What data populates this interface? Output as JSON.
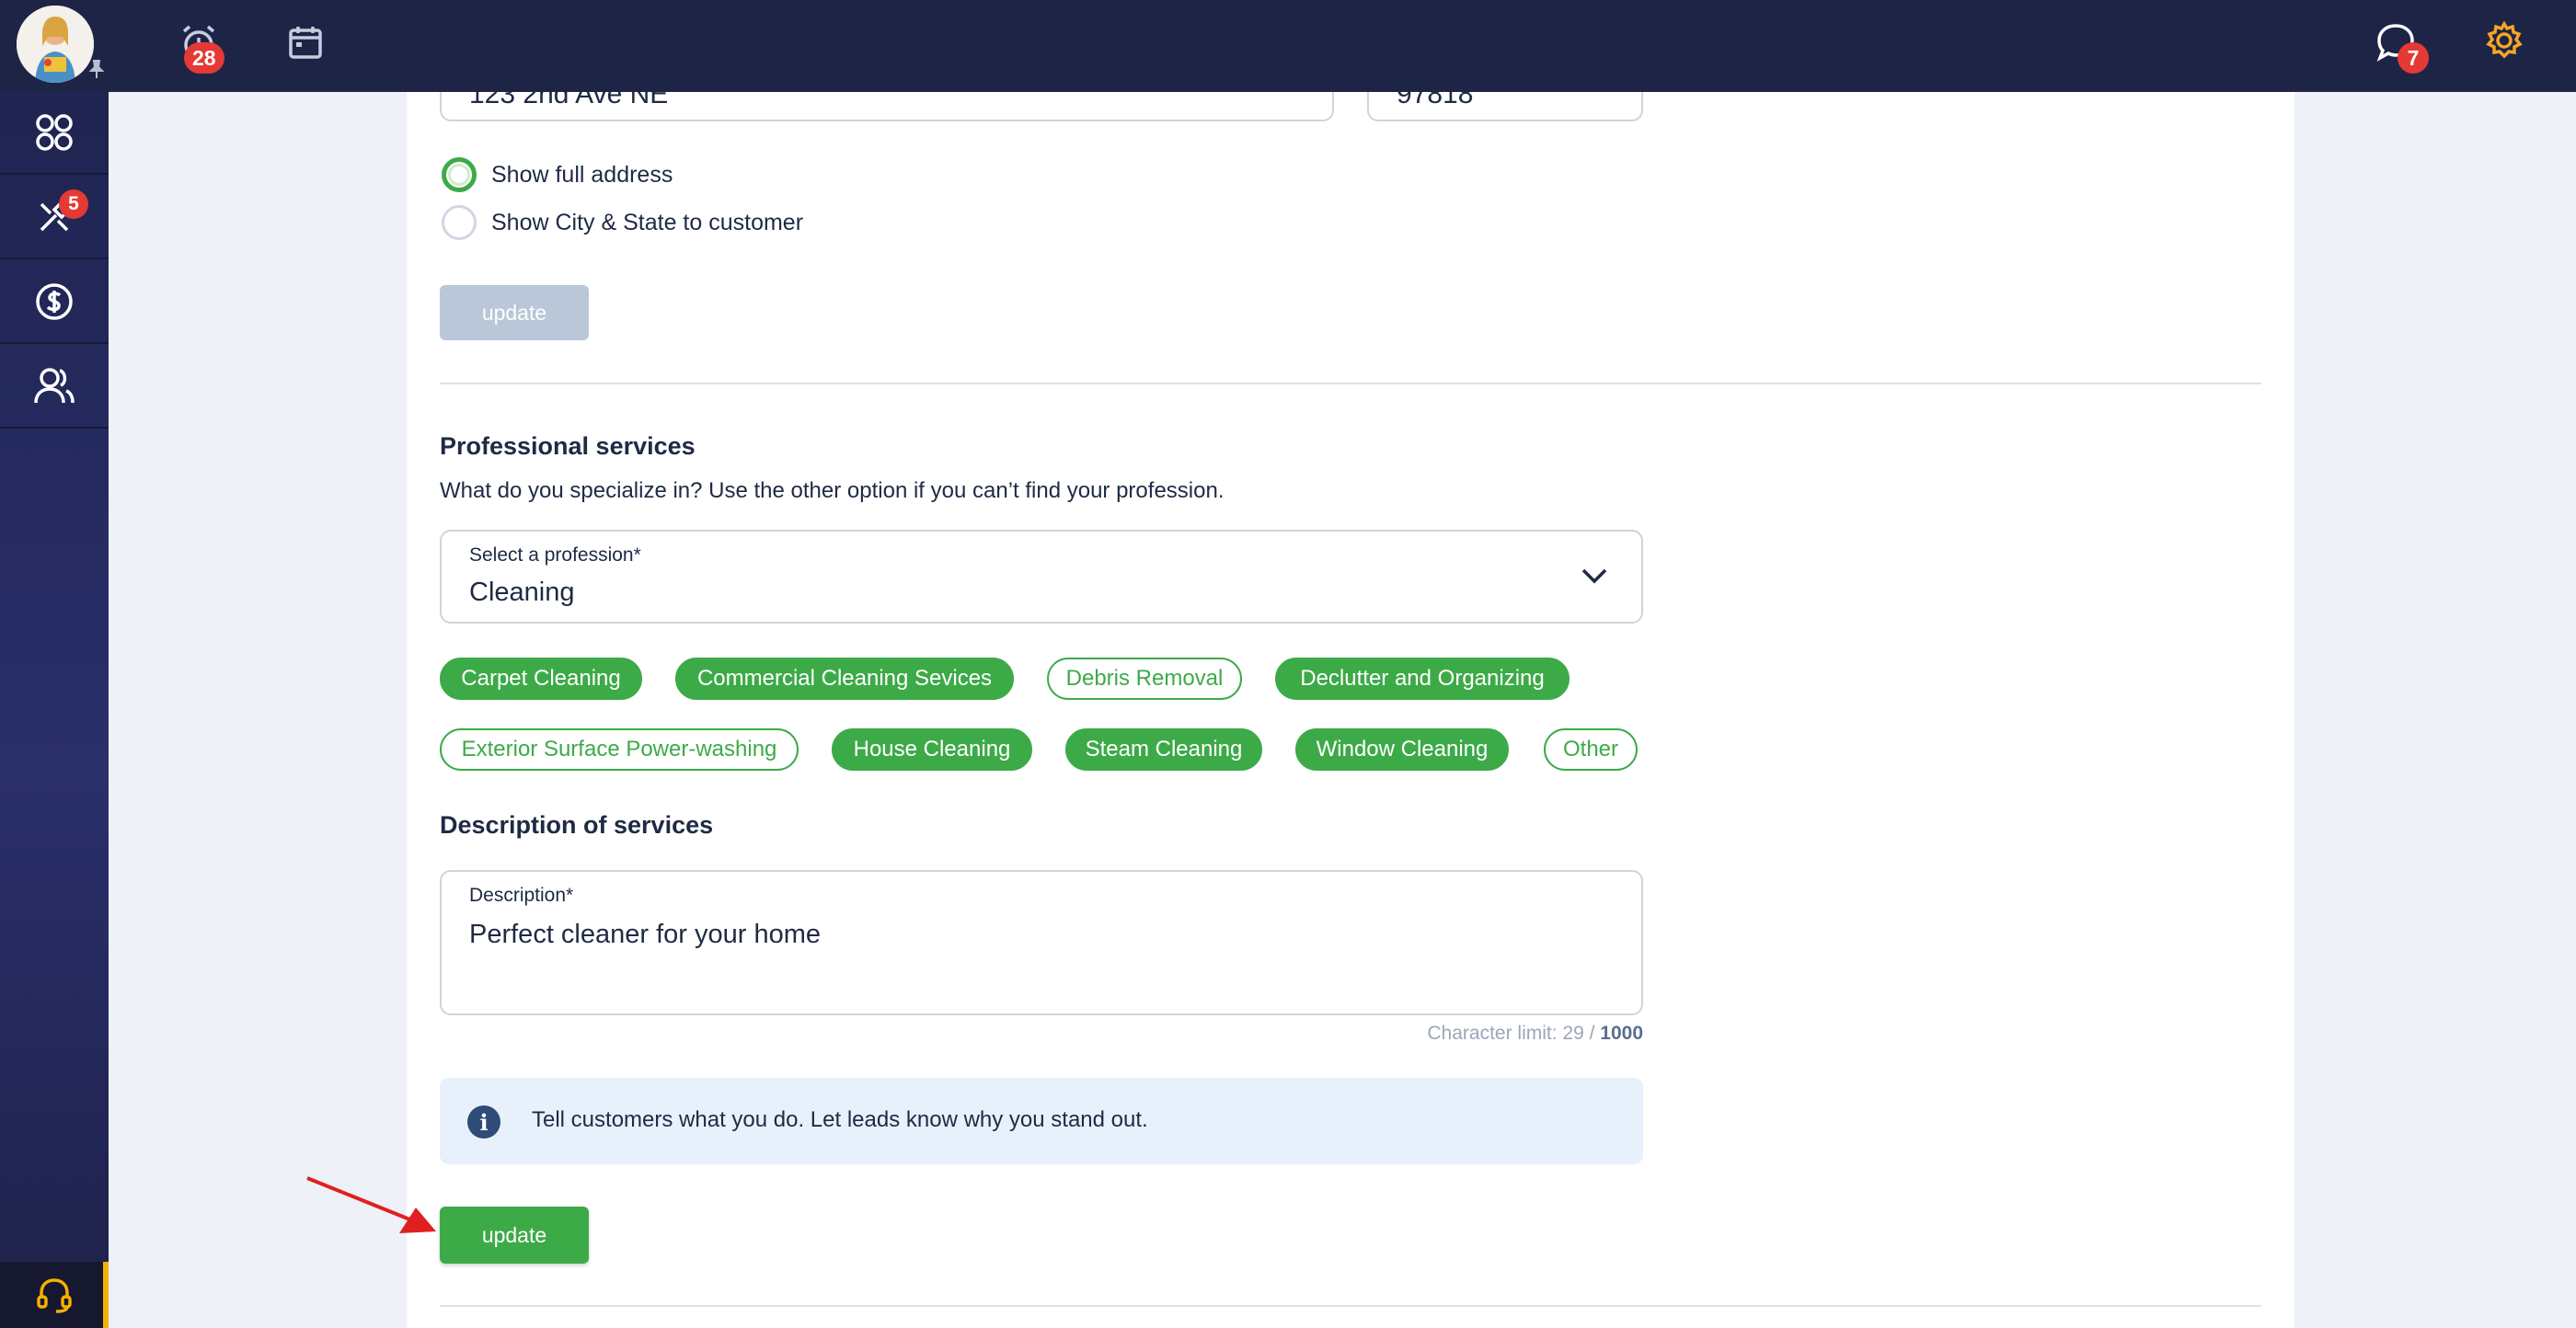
{
  "topbar": {
    "alarm_badge": "28",
    "messages_badge": "7"
  },
  "sidebar": {
    "tools_badge": "5"
  },
  "address": {
    "street_value": "123 2nd Ave NE",
    "zip_value": "97818"
  },
  "address_display": {
    "options": [
      {
        "label": "Show full address",
        "checked": true
      },
      {
        "label": "Show City & State to customer",
        "checked": false
      }
    ],
    "update_label": "update"
  },
  "professional": {
    "title": "Professional services",
    "subtitle": "What do you specialize in? Use the other option if you can’t find your profession.",
    "select_label": "Select a profession*",
    "select_value": "Cleaning",
    "chips": [
      {
        "label": "Carpet Cleaning",
        "selected": true
      },
      {
        "label": "Commercial Cleaning Sevices",
        "selected": true
      },
      {
        "label": "Debris Removal",
        "selected": false
      },
      {
        "label": "Declutter and Organizing",
        "selected": true
      },
      {
        "label": "Exterior Surface Power-washing",
        "selected": false
      },
      {
        "label": "House Cleaning",
        "selected": true
      },
      {
        "label": "Steam Cleaning",
        "selected": true
      },
      {
        "label": "Window Cleaning",
        "selected": true
      },
      {
        "label": "Other",
        "selected": false
      }
    ]
  },
  "description": {
    "title": "Description of services",
    "label": "Description*",
    "value": "Perfect cleaner for your home",
    "char_limit_prefix": "Character limit: 29 / ",
    "char_limit_max": "1000",
    "info_text": "Tell customers what you do. Let leads know why you stand out.",
    "update_label": "update"
  },
  "colors": {
    "primary_green": "#3daa48",
    "topbar_navy": "#1e2446",
    "badge_red": "#e53935",
    "settings_gold": "#f5a623",
    "info_bg": "#e8f0fb"
  }
}
